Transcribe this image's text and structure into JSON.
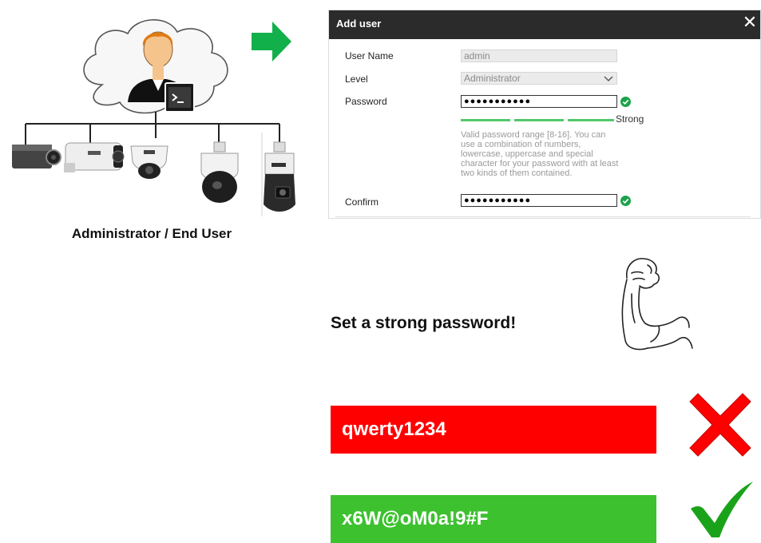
{
  "caption": "Administrator / End User",
  "dialog": {
    "title": "Add user",
    "close_symbol": "✕",
    "user_name_label": "User Name",
    "user_name_value": "admin",
    "level_label": "Level",
    "level_value": "Administrator",
    "password_label": "Password",
    "password_value": "●●●●●●●●●●●",
    "strength_label": "Strong",
    "strength_level": "3 of 3",
    "help_text": "Valid password range [8-16]. You can use a combination of numbers, lowercase, uppercase and special character for your password with at least two kinds of them contained.",
    "confirm_label": "Confirm",
    "confirm_value": "●●●●●●●●●●●"
  },
  "slogan": "Set a strong password!",
  "bad_password": "qwerty1234",
  "good_password": "x6W@oM0a!9#F",
  "colors": {
    "arrow": "#12b04a",
    "bad": "#ff0000",
    "good": "#3dc12f",
    "check": "#1aa31a",
    "dialog_header": "#2b2b2b",
    "strength": "#51c86a"
  },
  "icons": [
    "user-icon",
    "terminal-icon",
    "cloud-icon",
    "camera-icon",
    "arrow-right-icon",
    "close-icon",
    "check-circle-icon",
    "chevron-down-icon",
    "flexed-arm-icon",
    "cross-icon",
    "checkmark-icon"
  ]
}
